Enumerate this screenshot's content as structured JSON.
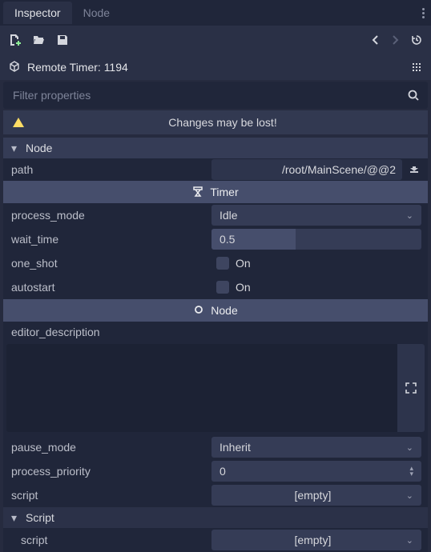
{
  "tabs": {
    "inspector": "Inspector",
    "node": "Node"
  },
  "breadcrumb": "Remote Timer: 1194",
  "filter_placeholder": "Filter properties",
  "warning": "Changes may be lost!",
  "section_node": "Node",
  "path": {
    "label": "path",
    "value": "/root/MainScene/@@2"
  },
  "cat_timer": "Timer",
  "process_mode": {
    "label": "process_mode",
    "value": "Idle"
  },
  "wait_time": {
    "label": "wait_time",
    "value": "0.5"
  },
  "one_shot": {
    "label": "one_shot",
    "value": "On"
  },
  "autostart": {
    "label": "autostart",
    "value": "On"
  },
  "cat_node": "Node",
  "editor_description": {
    "label": "editor_description",
    "value": ""
  },
  "pause_mode": {
    "label": "pause_mode",
    "value": "Inherit"
  },
  "process_priority": {
    "label": "process_priority",
    "value": "0"
  },
  "script1": {
    "label": "script",
    "value": "[empty]"
  },
  "sub_script": "Script",
  "script2": {
    "label": "script",
    "value": "[empty]"
  }
}
